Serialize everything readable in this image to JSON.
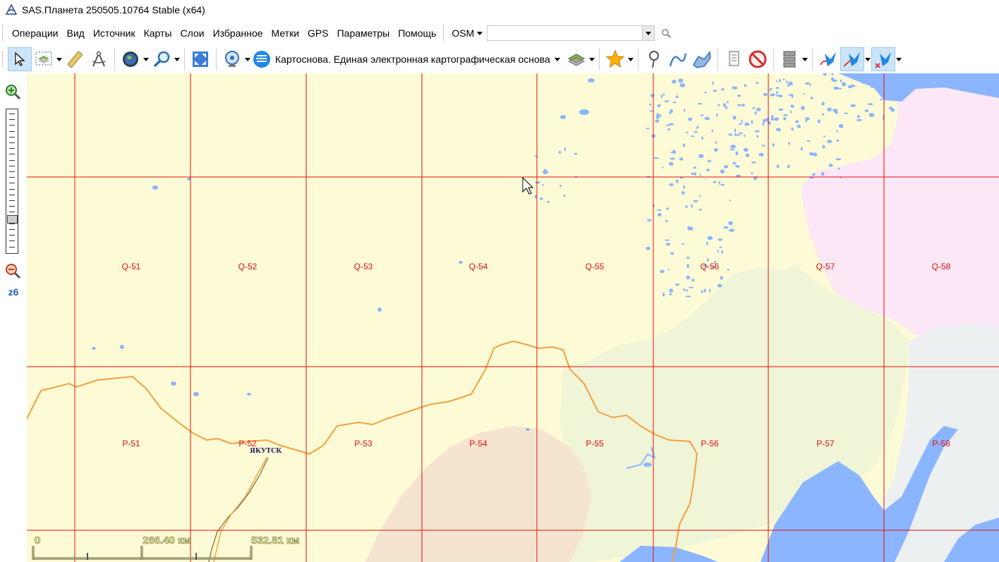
{
  "window": {
    "title": "SAS.Планета 250505.10764 Stable (x64)"
  },
  "menu": {
    "items": [
      "Операции",
      "Вид",
      "Источник",
      "Карты",
      "Слои",
      "Избранное",
      "Метки",
      "GPS",
      "Параметры",
      "Помощь"
    ],
    "osm_label": "OSM",
    "search_value": "",
    "search_placeholder": ""
  },
  "toolbar": {
    "map_source": "Картоснова. Единая электронная картографическая основа",
    "icons": [
      "cursor-icon",
      "layers-icon",
      "ruler-icon",
      "compass-icon",
      "globe-icon",
      "zoom-icon",
      "fullscreen-icon",
      "gps-icon",
      "map-source-icon",
      "layer-stack-icon",
      "star-icon",
      "marker-icon",
      "path-icon",
      "polygon-icon",
      "note-icon",
      "no-icon",
      "database-icon",
      "gps-track-icon",
      "gps-track-active-icon",
      "gps-track-2-icon"
    ]
  },
  "zoom": {
    "level_label": "z6",
    "position": 0.78
  },
  "map": {
    "sheets": [
      "Q-51",
      "Q-52",
      "Q-53",
      "Q-54",
      "Q-55",
      "Q-56",
      "Q-57",
      "Q-58",
      "P-51",
      "P-52",
      "P-53",
      "P-54",
      "P-55",
      "P-56",
      "P-57",
      "P-58"
    ],
    "city_label": "ЯКУТСК",
    "scale": {
      "start": "0",
      "mid": "266.40 км",
      "end": "532.81 км"
    },
    "colors": {
      "background": "#fdfbd6",
      "grid": "#e01010",
      "water": "#8cb5ff",
      "road": "#f5a040",
      "pink": "#fbe7f5",
      "green": "#f0f5d8",
      "tan": "#f5e4d0",
      "grey": "#ecf0f0"
    }
  }
}
